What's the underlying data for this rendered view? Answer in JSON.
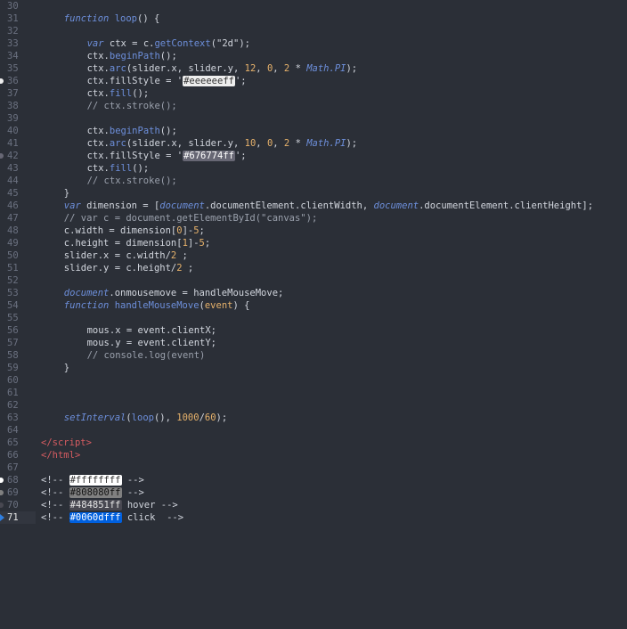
{
  "editor": {
    "accent": "#2f7fe0",
    "lines": [
      {
        "n": "30",
        "active": false,
        "indent": 0,
        "tokens": []
      },
      {
        "n": "31",
        "active": false,
        "indent": 4,
        "tokens": [
          {
            "t": "function",
            "c": "kw"
          },
          {
            "t": " "
          },
          {
            "t": "loop",
            "c": "fn"
          },
          {
            "t": "() {"
          }
        ]
      },
      {
        "n": "32",
        "active": false,
        "indent": 0,
        "tokens": []
      },
      {
        "n": "33",
        "active": false,
        "indent": 8,
        "tokens": [
          {
            "t": "var",
            "c": "kw"
          },
          {
            "t": " ctx = c."
          },
          {
            "t": "getContext",
            "c": "fn"
          },
          {
            "t": "("
          },
          {
            "t": "\"2d\"",
            "c": "str"
          },
          {
            "t": ");"
          }
        ]
      },
      {
        "n": "34",
        "active": false,
        "indent": 8,
        "tokens": [
          {
            "t": "ctx."
          },
          {
            "t": "beginPath",
            "c": "fn"
          },
          {
            "t": "();"
          }
        ]
      },
      {
        "n": "35",
        "active": false,
        "indent": 8,
        "tokens": [
          {
            "t": "ctx."
          },
          {
            "t": "arc",
            "c": "fn"
          },
          {
            "t": "(slider.x, slider.y, "
          },
          {
            "t": "12",
            "c": "num"
          },
          {
            "t": ", "
          },
          {
            "t": "0",
            "c": "num"
          },
          {
            "t": ", "
          },
          {
            "t": "2",
            "c": "num"
          },
          {
            "t": " * "
          },
          {
            "t": "Math.PI",
            "c": "kw"
          },
          {
            "t": ");"
          }
        ]
      },
      {
        "n": "36",
        "active": false,
        "marker": "#eeeeee",
        "indent": 8,
        "tokens": [
          {
            "t": "ctx.fillStyle = '"
          },
          {
            "t": "#eeeeeeff",
            "sw": "#eeeeee",
            "fg": "#333"
          },
          {
            "t": "';"
          }
        ]
      },
      {
        "n": "37",
        "active": false,
        "indent": 8,
        "tokens": [
          {
            "t": "ctx."
          },
          {
            "t": "fill",
            "c": "fn"
          },
          {
            "t": "();"
          }
        ]
      },
      {
        "n": "38",
        "active": false,
        "indent": 8,
        "tokens": [
          {
            "t": "// ctx.stroke();",
            "c": "comment"
          }
        ]
      },
      {
        "n": "39",
        "active": false,
        "indent": 0,
        "tokens": []
      },
      {
        "n": "40",
        "active": false,
        "indent": 8,
        "tokens": [
          {
            "t": "ctx."
          },
          {
            "t": "beginPath",
            "c": "fn"
          },
          {
            "t": "();"
          }
        ]
      },
      {
        "n": "41",
        "active": false,
        "indent": 8,
        "tokens": [
          {
            "t": "ctx."
          },
          {
            "t": "arc",
            "c": "fn"
          },
          {
            "t": "(slider.x, slider.y, "
          },
          {
            "t": "10",
            "c": "num"
          },
          {
            "t": ", "
          },
          {
            "t": "0",
            "c": "num"
          },
          {
            "t": ", "
          },
          {
            "t": "2",
            "c": "num"
          },
          {
            "t": " * "
          },
          {
            "t": "Math.PI",
            "c": "kw"
          },
          {
            "t": ");"
          }
        ]
      },
      {
        "n": "42",
        "active": false,
        "marker": "#676774",
        "indent": 8,
        "tokens": [
          {
            "t": "ctx.fillStyle = '"
          },
          {
            "t": "#676774ff",
            "sw": "#676774",
            "fg": "#ffffff"
          },
          {
            "t": "';"
          }
        ]
      },
      {
        "n": "43",
        "active": false,
        "indent": 8,
        "tokens": [
          {
            "t": "ctx."
          },
          {
            "t": "fill",
            "c": "fn"
          },
          {
            "t": "();"
          }
        ]
      },
      {
        "n": "44",
        "active": false,
        "indent": 8,
        "tokens": [
          {
            "t": "// ctx.stroke();",
            "c": "comment"
          }
        ]
      },
      {
        "n": "45",
        "active": false,
        "indent": 4,
        "tokens": [
          {
            "t": "}"
          }
        ]
      },
      {
        "n": "46",
        "active": false,
        "indent": 4,
        "tokens": [
          {
            "t": "var",
            "c": "kw"
          },
          {
            "t": " dimension = ["
          },
          {
            "t": "document",
            "c": "kw"
          },
          {
            "t": ".documentElement.clientWidth, "
          },
          {
            "t": "document",
            "c": "kw"
          },
          {
            "t": ".documentElement.clientHeight];"
          }
        ]
      },
      {
        "n": "47",
        "active": false,
        "indent": 4,
        "tokens": [
          {
            "t": "// var c = document.getElementById(\"canvas\");",
            "c": "comment"
          }
        ]
      },
      {
        "n": "48",
        "active": false,
        "indent": 4,
        "tokens": [
          {
            "t": "c.width = dimension["
          },
          {
            "t": "0",
            "c": "num"
          },
          {
            "t": "]-"
          },
          {
            "t": "5",
            "c": "num"
          },
          {
            "t": ";"
          }
        ]
      },
      {
        "n": "49",
        "active": false,
        "indent": 4,
        "tokens": [
          {
            "t": "c.height = dimension["
          },
          {
            "t": "1",
            "c": "num"
          },
          {
            "t": "]-"
          },
          {
            "t": "5",
            "c": "num"
          },
          {
            "t": ";"
          }
        ]
      },
      {
        "n": "50",
        "active": false,
        "indent": 4,
        "tokens": [
          {
            "t": "slider.x = c.width/"
          },
          {
            "t": "2",
            "c": "num"
          },
          {
            "t": " ;"
          }
        ]
      },
      {
        "n": "51",
        "active": false,
        "indent": 4,
        "tokens": [
          {
            "t": "slider.y = c.height/"
          },
          {
            "t": "2",
            "c": "num"
          },
          {
            "t": " ;"
          }
        ]
      },
      {
        "n": "52",
        "active": false,
        "indent": 0,
        "tokens": []
      },
      {
        "n": "53",
        "active": false,
        "indent": 4,
        "tokens": [
          {
            "t": "document",
            "c": "kw"
          },
          {
            "t": ".onmousemove = handleMouseMove;"
          }
        ]
      },
      {
        "n": "54",
        "active": false,
        "indent": 4,
        "tokens": [
          {
            "t": "function",
            "c": "kw"
          },
          {
            "t": " "
          },
          {
            "t": "handleMouseMove",
            "c": "fn"
          },
          {
            "t": "("
          },
          {
            "t": "event",
            "c": "num"
          },
          {
            "t": ") {"
          }
        ]
      },
      {
        "n": "55",
        "active": false,
        "indent": 0,
        "tokens": []
      },
      {
        "n": "56",
        "active": false,
        "indent": 8,
        "tokens": [
          {
            "t": "mous.x = event.clientX;"
          }
        ]
      },
      {
        "n": "57",
        "active": false,
        "indent": 8,
        "tokens": [
          {
            "t": "mous.y = event.clientY;"
          }
        ]
      },
      {
        "n": "58",
        "active": false,
        "indent": 8,
        "tokens": [
          {
            "t": "// console.log(event)",
            "c": "comment"
          }
        ]
      },
      {
        "n": "59",
        "active": false,
        "indent": 4,
        "tokens": [
          {
            "t": "}"
          }
        ]
      },
      {
        "n": "60",
        "active": false,
        "indent": 0,
        "tokens": []
      },
      {
        "n": "61",
        "active": false,
        "indent": 0,
        "tokens": []
      },
      {
        "n": "62",
        "active": false,
        "indent": 0,
        "tokens": []
      },
      {
        "n": "63",
        "active": false,
        "indent": 4,
        "tokens": [
          {
            "t": "setInterval",
            "c": "kw"
          },
          {
            "t": "("
          },
          {
            "t": "loop",
            "c": "fn"
          },
          {
            "t": "(), "
          },
          {
            "t": "1000",
            "c": "num"
          },
          {
            "t": "/"
          },
          {
            "t": "60",
            "c": "num"
          },
          {
            "t": ");"
          }
        ]
      },
      {
        "n": "64",
        "active": false,
        "indent": 0,
        "tokens": []
      },
      {
        "n": "65",
        "active": false,
        "indent": 0,
        "tokens": [
          {
            "t": "</",
            "c": "tag"
          },
          {
            "t": "script",
            "c": "tag"
          },
          {
            "t": ">",
            "c": "tag"
          }
        ]
      },
      {
        "n": "66",
        "active": false,
        "indent": 0,
        "tokens": [
          {
            "t": "</",
            "c": "tag"
          },
          {
            "t": "html",
            "c": "tag"
          },
          {
            "t": ">",
            "c": "tag"
          }
        ]
      },
      {
        "n": "67",
        "active": false,
        "indent": 0,
        "tokens": []
      },
      {
        "n": "68",
        "active": false,
        "marker": "#ffffff",
        "indent": 0,
        "tokens": [
          {
            "t": "<!-- "
          },
          {
            "t": "#ffffffff",
            "sw": "#ffffff",
            "fg": "#333"
          },
          {
            "t": " -->"
          }
        ]
      },
      {
        "n": "69",
        "active": false,
        "marker": "#808080",
        "indent": 0,
        "tokens": [
          {
            "t": "<!-- "
          },
          {
            "t": "#808080ff",
            "sw": "#808080",
            "fg": "#111"
          },
          {
            "t": " -->"
          }
        ]
      },
      {
        "n": "70",
        "active": false,
        "marker": "#484851",
        "indent": 0,
        "tokens": [
          {
            "t": "<!-- "
          },
          {
            "t": "#484851ff",
            "sw": "#484851",
            "fg": "#e6e6e6"
          },
          {
            "t": " hover -->"
          }
        ]
      },
      {
        "n": "71",
        "active": true,
        "marker": "caret",
        "indent": 0,
        "tokens": [
          {
            "t": "<!-- "
          },
          {
            "t": "#0060dfff",
            "sw": "#0060df",
            "fg": "#ffffff"
          },
          {
            "t": " click  -->"
          }
        ]
      }
    ]
  }
}
